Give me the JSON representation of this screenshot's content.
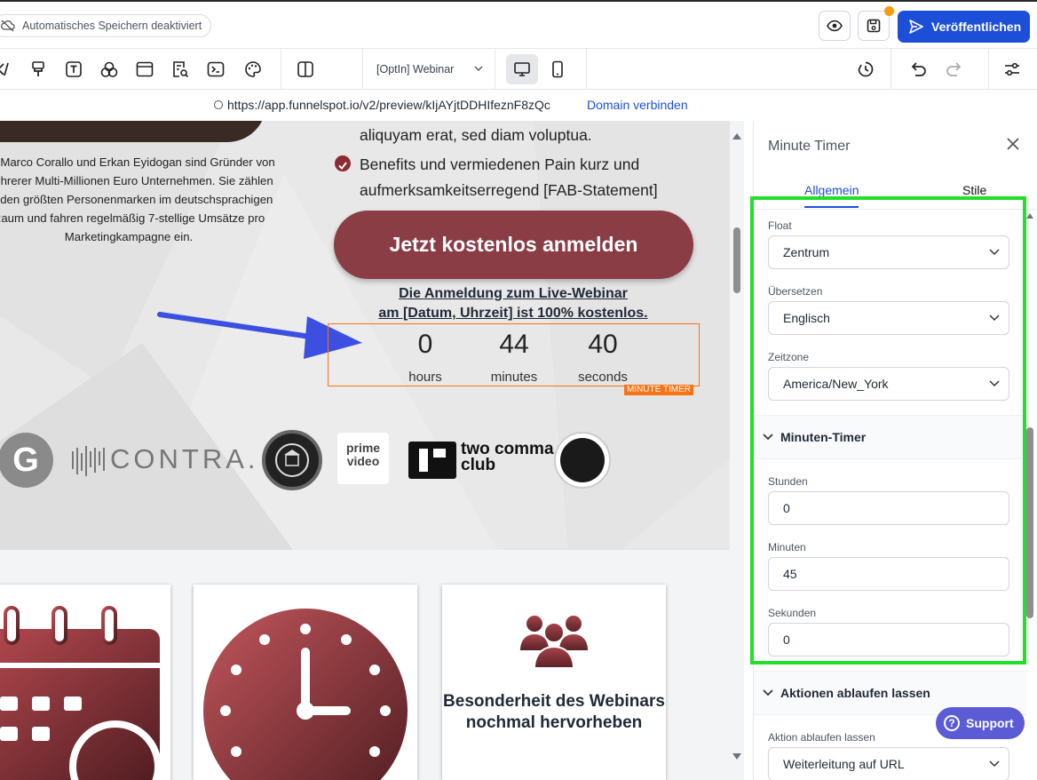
{
  "header": {
    "autosave_label": "Automatisches Speichern deaktiviert",
    "publish_label": "Veröffentlichen",
    "accent_color": "#1d4ed8"
  },
  "toolbar": {
    "icons": [
      "code-icon",
      "brush-icon",
      "text-icon",
      "shapes-icon",
      "layout-icon",
      "form-icon",
      "terminal-icon",
      "palette-icon",
      "split-view-icon",
      "history-icon",
      "undo-icon",
      "redo-icon",
      "settings-sliders-icon"
    ],
    "page_select": "[OptIn] Webinar"
  },
  "urlbar": {
    "url": "https://app.funnelspot.io/v2/preview/kIjAYjtDDHIfeznF8zQc",
    "domain_link": "Domain verbinden"
  },
  "canvas": {
    "bio": "⭐ Marco Corallo und Erkan Eyidogan sind Gründer von mehrerer Multi-Millionen Euro Unternehmen. Sie zählen zu den größten Personenmarken im deutschsprachigen Raum und fahren regelmäßig 7-stellige Umsätze pro Marketingkampagne ein.",
    "benefit_top": "aliquyam erat, sed diam voluptua.",
    "benefit": "Benefits und vermiedenen Pain kurz und aufmerksamkeitserregend [FAB-Statement]",
    "cta_label": "Jetzt kostenlos anmelden",
    "note_line1": "Die Anmeldung zum Live-Webinar",
    "note_line2": "am [Datum, Uhrzeit] ist 100% kostenlos.",
    "timer": {
      "hours_value": "0",
      "hours_label": "hours",
      "minutes_value": "44",
      "minutes_label": "minutes",
      "seconds_value": "40",
      "seconds_label": "seconds",
      "tag": "MINUTE TIMER"
    },
    "logos": {
      "g": "G",
      "contra": "CONTRA.",
      "prime_line1": "prime",
      "prime_line2": "video",
      "two_comma_line1": "two comma",
      "two_comma_line2": "club"
    },
    "card3_text": "Besonderheit des Webinars nochmal hervorheben"
  },
  "panel": {
    "title": "Minute Timer",
    "tabs": [
      "Allgemein",
      "Stile"
    ],
    "float_label": "Float",
    "float_value": "Zentrum",
    "translate_label": "Übersetzen",
    "translate_value": "Englisch",
    "timezone_label": "Zeitzone",
    "timezone_value": "America/New_York",
    "section_timer": "Minuten-Timer",
    "hours_label": "Stunden",
    "hours_value": "0",
    "minutes_label": "Minuten",
    "minutes_value": "45",
    "seconds_label": "Sekunden",
    "seconds_value": "0",
    "section_actions": "Aktionen ablaufen lassen",
    "action_label": "Aktion ablaufen lassen",
    "action_value": "Weiterleitung auf URL",
    "highlight_color": "#22e02a"
  },
  "support_label": "Support"
}
